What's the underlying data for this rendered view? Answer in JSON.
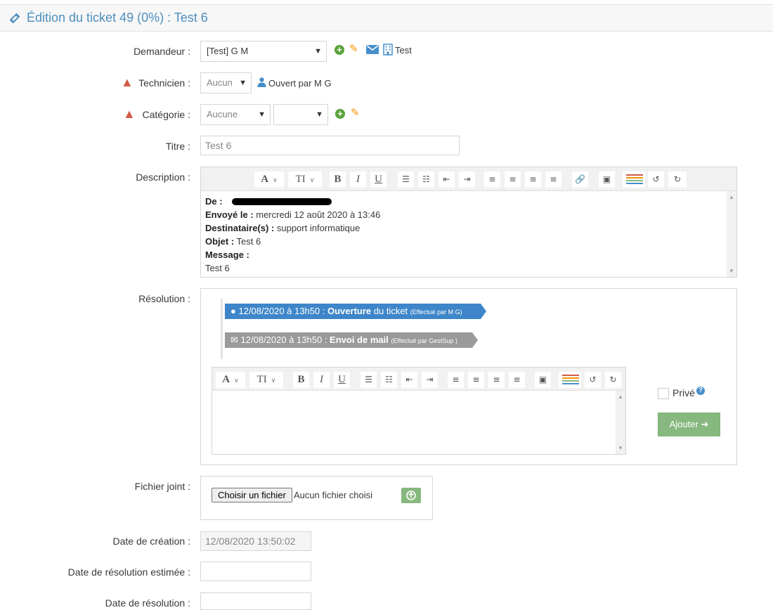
{
  "header": {
    "title": "Édition du ticket 49 (0%) : Test 6",
    "icon": "ticket-icon"
  },
  "form": {
    "demandeur": {
      "label": "Demandeur :",
      "value": "[Test] G M",
      "building_label": "Test"
    },
    "technicien": {
      "label": "Technicien :",
      "value": "Aucun",
      "opened_by": "Ouvert par M G"
    },
    "categorie": {
      "label": "Catégorie :",
      "value": "Aucune",
      "subvalue": ""
    },
    "titre": {
      "label": "Titre :",
      "value": "Test 6"
    },
    "description": {
      "label": "Description :",
      "lines": [
        {
          "key": "De :",
          "value": ""
        },
        {
          "key": "Envoyé le :",
          "value": " mercredi 12 août 2020 à 13:46"
        },
        {
          "key": "Destinataire(s) :",
          "value": " support informatique"
        },
        {
          "key": "Objet :",
          "value": " Test 6"
        },
        {
          "key": "Message :",
          "value": ""
        },
        {
          "key": "",
          "value": "Test 6"
        }
      ]
    },
    "resolution": {
      "label": "Résolution :",
      "events": [
        {
          "date": "12/08/2020 à 13h50 :",
          "action_bold": "Ouverture",
          "action_rest": " du ticket",
          "by": "(Effectué par M G)"
        },
        {
          "date": "12/08/2020 à 13h50 :",
          "action_bold": "Envoi de mail",
          "action_rest": "",
          "by": "(Effectué par GestSup )"
        }
      ],
      "private_label": "Privé",
      "add_button": "Ajouter"
    },
    "fichier": {
      "label": "Fichier joint :",
      "button": "Choisir un fichier",
      "status": "Aucun fichier choisi"
    },
    "date_creation": {
      "label": "Date de création :",
      "value": "12/08/2020 13:50:02"
    },
    "date_resolution_estimee": {
      "label": "Date de résolution estimée :",
      "value": ""
    },
    "date_resolution": {
      "label": "Date de résolution :",
      "value": ""
    }
  },
  "colors": {
    "accent": "#4c8fbd",
    "timeline_blue": "#3e86c9",
    "timeline_gray": "#9a9a9a",
    "success": "#87b87f",
    "warning": "#d15b47",
    "edit": "#f89406"
  }
}
